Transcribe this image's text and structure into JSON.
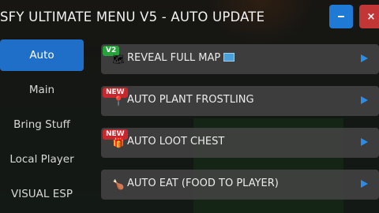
{
  "window": {
    "title": "SFY ULTIMATE MENU V5 - AUTO UPDATE",
    "minimize_label": "",
    "close_label": "×"
  },
  "sidebar": {
    "items": [
      {
        "label": "Auto",
        "active": true
      },
      {
        "label": "Main",
        "active": false
      },
      {
        "label": "Bring Stuff",
        "active": false
      },
      {
        "label": "Local Player",
        "active": false
      },
      {
        "label": "VISUAL ESP",
        "active": false
      }
    ]
  },
  "content": {
    "rows": [
      {
        "badge": "V2",
        "icon": "map-icon",
        "label": "REVEAL FULL MAP"
      },
      {
        "badge": "NEW",
        "icon": "pin-icon",
        "label": "AUTO PLANT FROSTLING"
      },
      {
        "badge": "NEW",
        "icon": "gift-icon",
        "label": "AUTO LOOT CHEST"
      },
      {
        "badge": "",
        "icon": "drumstick-icon",
        "label": "AUTO EAT (FOOD TO PLAYER)"
      }
    ]
  },
  "colors": {
    "accent": "#1f6fc9",
    "close": "#c23636",
    "badge_new": "#c8282d",
    "badge_v2": "#27a23c"
  }
}
